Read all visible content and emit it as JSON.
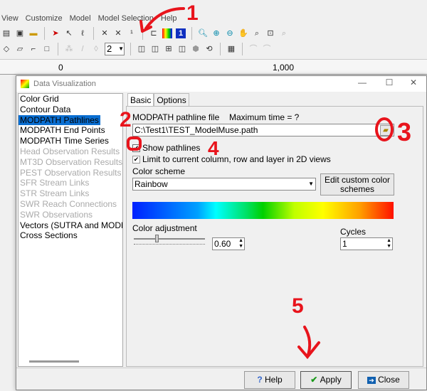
{
  "menu": [
    "View",
    "Customize",
    "Model",
    "Model Selection",
    "Help"
  ],
  "toolbar": {
    "layer_select": "2"
  },
  "ruler": {
    "labels": [
      "0",
      "1,000"
    ]
  },
  "dialog": {
    "title": "Data Visualization",
    "list": [
      {
        "label": "Color Grid",
        "enabled": true
      },
      {
        "label": "Contour Data",
        "enabled": true
      },
      {
        "label": "MODPATH Pathlines",
        "enabled": true,
        "selected": true
      },
      {
        "label": "MODPATH End Points",
        "enabled": true
      },
      {
        "label": "MODPATH Time Series",
        "enabled": true
      },
      {
        "label": "Head Observation Results",
        "enabled": false
      },
      {
        "label": "MT3D Observation Results",
        "enabled": false
      },
      {
        "label": "PEST Observation Results",
        "enabled": false
      },
      {
        "label": "SFR Stream Links",
        "enabled": false
      },
      {
        "label": "STR Stream Links",
        "enabled": false
      },
      {
        "label": "SWR Reach Connections",
        "enabled": false
      },
      {
        "label": "SWR Observations",
        "enabled": false
      },
      {
        "label": "Vectors (SUTRA and MODF",
        "enabled": true
      },
      {
        "label": "Cross Sections",
        "enabled": true
      }
    ],
    "tabs": [
      "Basic",
      "Options"
    ],
    "pathline_file_label": "MODPATH pathline file",
    "max_time_label": "Maximum time = ?",
    "pathline_file": "C:\\Test1\\TEST_ModelMuse.path",
    "show_pathlines": "Show pathlines",
    "limit_label": "Limit to current column, row and layer in 2D views",
    "color_scheme_label": "Color scheme",
    "color_scheme": "Rainbow",
    "edit_schemes": "Edit custom color schemes",
    "color_adjustment_label": "Color adjustment",
    "color_adjustment": "0.60",
    "cycles_label": "Cycles",
    "cycles": "1",
    "help": "Help",
    "apply": "Apply",
    "close": "Close"
  },
  "annotations": [
    "1",
    "2",
    "3",
    "4",
    "5"
  ],
  "colors": {
    "annotation": "#e8141c",
    "selection": "#0a6ed1"
  }
}
